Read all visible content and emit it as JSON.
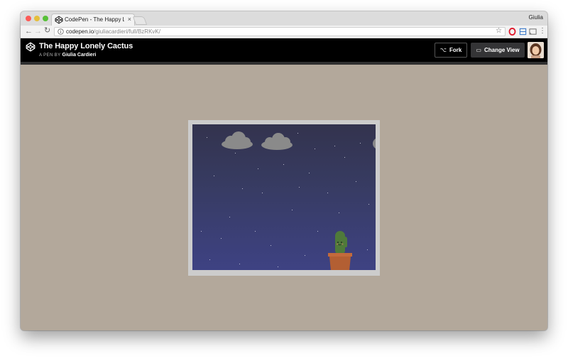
{
  "browser": {
    "tab_title": "CodePen - The Happy Lonely Cactus",
    "tab_close": "×",
    "user": "Giulia",
    "url_host": "codepen.io",
    "url_path": "/giuliacardieri/full/BzRKvK/",
    "nav_back": "←",
    "nav_forward": "→",
    "nav_reload": "↻",
    "bookmark": "☆",
    "menu": "⋮"
  },
  "header": {
    "title": "The Happy Lonely Cactus",
    "by_label": "A PEN BY",
    "author": "Giulia Cardieri",
    "fork_label": "Fork",
    "fork_icon": "⌥",
    "change_view_label": "Change View",
    "change_view_icon": "▭"
  },
  "colors": {
    "page_bg": "#b3a89b",
    "header_bg": "#000000",
    "frame": "#cccccc",
    "sky_top": "#33334e",
    "sky_bottom": "#3e4283",
    "cloud": "#888888",
    "cactus": "#4f7a3a",
    "pot": "#c26a3b"
  },
  "icons": [
    "codepen-logo-icon",
    "info-icon",
    "star-icon",
    "opera-icon",
    "extension-icon",
    "cast-icon",
    "menu-dots-icon",
    "fork-icon",
    "change-view-icon"
  ]
}
